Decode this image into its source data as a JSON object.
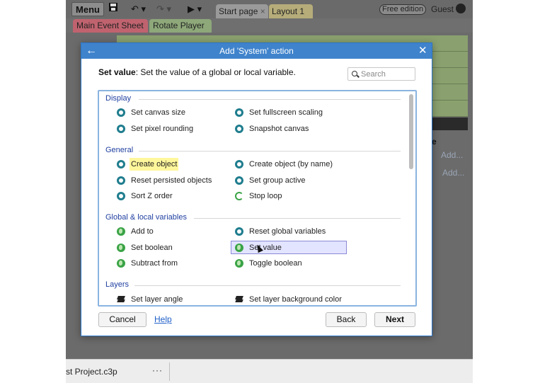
{
  "toolbar": {
    "menu_label": "Menu",
    "save_icon": "save-icon",
    "undo_icon": "undo-icon",
    "redo_icon": "redo-icon",
    "play_icon": "play-icon",
    "tabs": [
      {
        "label": "Start page",
        "close": "×"
      },
      {
        "label": "Layout 1",
        "close": "×"
      }
    ],
    "edition_badge": "Free edition",
    "user_label": "Guest"
  },
  "subtabs": [
    {
      "label": "Main Event Sheet",
      "close": "×"
    },
    {
      "label": "Rotate Player",
      "close": "×"
    }
  ],
  "sheet": {
    "add_links": [
      "Add...",
      "Add..."
    ],
    "side_text": "e"
  },
  "statusbar": {
    "project_name": "st Project.c3p",
    "more": "···"
  },
  "dialog": {
    "title": "Add 'System' action",
    "back_icon": "←",
    "close_icon": "✕",
    "description_bold": "Set value",
    "description_rest": ": Set the value of a global or local variable.",
    "search_placeholder": "Search",
    "groups": [
      {
        "name": "Display",
        "actions": [
          {
            "label": "Set canvas size",
            "icon": "gear-icon"
          },
          {
            "label": "Set fullscreen scaling",
            "icon": "gear-icon"
          },
          {
            "label": "Set pixel rounding",
            "icon": "gear-icon"
          },
          {
            "label": "Snapshot canvas",
            "icon": "gear-icon"
          }
        ]
      },
      {
        "name": "General",
        "actions": [
          {
            "label": "Create object",
            "icon": "gear-icon",
            "highlighted": true
          },
          {
            "label": "Create object (by name)",
            "icon": "gear-icon"
          },
          {
            "label": "Reset persisted objects",
            "icon": "gear-icon"
          },
          {
            "label": "Set group active",
            "icon": "gear-icon"
          },
          {
            "label": "Sort Z order",
            "icon": "gear-icon"
          },
          {
            "label": "Stop loop",
            "icon": "loop-icon"
          }
        ]
      },
      {
        "name": "Global & local variables",
        "actions": [
          {
            "label": "Add to",
            "icon": "globe-icon"
          },
          {
            "label": "Reset global variables",
            "icon": "gear-icon"
          },
          {
            "label": "Set boolean",
            "icon": "globe-icon"
          },
          {
            "label": "Set value",
            "icon": "globe-icon",
            "selected": true
          },
          {
            "label": "Subtract from",
            "icon": "globe-icon"
          },
          {
            "label": "Toggle boolean",
            "icon": "globe-icon"
          }
        ]
      },
      {
        "name": "Layers",
        "actions": [
          {
            "label": "Set layer angle",
            "icon": "layers-icon"
          },
          {
            "label": "Set layer background color",
            "icon": "layers-icon"
          }
        ]
      }
    ],
    "buttons": {
      "cancel": "Cancel",
      "help": "Help",
      "back": "Back",
      "next": "Next"
    }
  },
  "colors": {
    "dialog_header": "#3f83cc",
    "group_header": "#1f3fa0",
    "gear_icon": "#1f7d8e",
    "globe_icon": "#3aa346",
    "highlight": "#fff79b",
    "selected_row": "#e3e4ff"
  }
}
